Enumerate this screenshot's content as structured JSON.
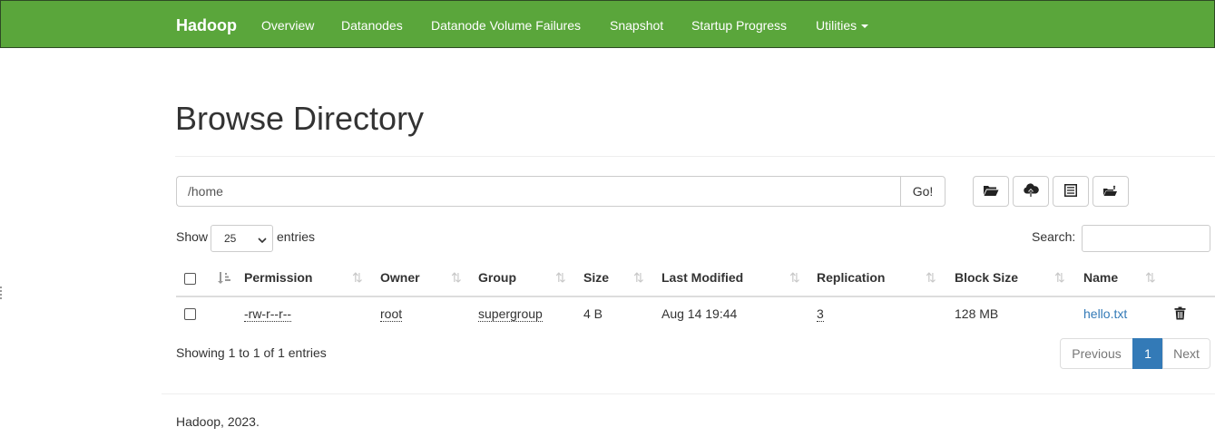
{
  "nav": {
    "brand": "Hadoop",
    "items": [
      {
        "label": "Overview"
      },
      {
        "label": "Datanodes"
      },
      {
        "label": "Datanode Volume Failures"
      },
      {
        "label": "Snapshot"
      },
      {
        "label": "Startup Progress"
      },
      {
        "label": "Utilities"
      }
    ]
  },
  "header": {
    "title": "Browse Directory"
  },
  "path": {
    "value": "/home",
    "go_label": "Go!"
  },
  "toolbar": {
    "icons": [
      "folder-open-icon",
      "cloud-upload-icon",
      "list-alt-icon",
      "create-folder-icon"
    ]
  },
  "table_controls": {
    "show_label": "Show",
    "page_length": "25",
    "entries_label": "entries",
    "search_label": "Search:",
    "search_value": ""
  },
  "table": {
    "columns": [
      "Permission",
      "Owner",
      "Group",
      "Size",
      "Last Modified",
      "Replication",
      "Block Size",
      "Name"
    ],
    "rows": [
      {
        "permission": "-rw-r--r--",
        "owner": "root",
        "group": "supergroup",
        "size": "4 B",
        "last_modified": "Aug 14 19:44",
        "replication": "3",
        "block_size": "128 MB",
        "name": "hello.txt"
      }
    ]
  },
  "info": "Showing 1 to 1 of 1 entries",
  "pagination": {
    "previous": "Previous",
    "current": "1",
    "next": "Next"
  },
  "footer": "Hadoop, 2023.",
  "colors": {
    "navbar": "#5aa63b",
    "link": "#337ab7",
    "active_page": "#337ab7"
  }
}
